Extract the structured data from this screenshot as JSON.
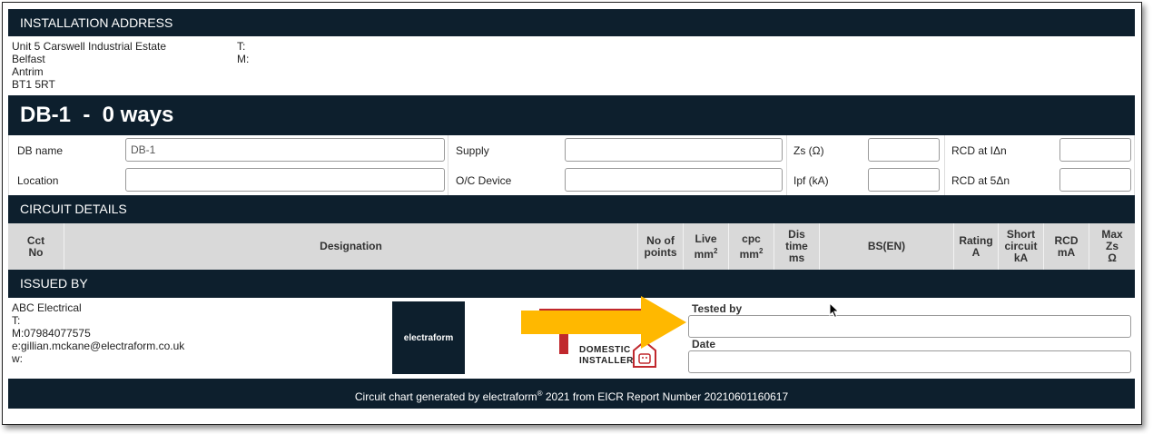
{
  "installation": {
    "title": "INSTALLATION ADDRESS",
    "address_lines": [
      "Unit 5 Carswell Industrial Estate",
      "Belfast",
      "Antrim",
      "BT1 5RT"
    ],
    "phone_label": "T:",
    "mobile_label": "M:"
  },
  "db": {
    "heading": "DB-1  -  0 ways",
    "fields": {
      "db_name_label": "DB name",
      "db_name_value": "DB-1",
      "location_label": "Location",
      "location_value": "",
      "supply_label": "Supply",
      "supply_value": "",
      "oc_device_label": "O/C Device",
      "oc_device_value": "",
      "zs_label": "Zs (Ω)",
      "zs_value": "",
      "ipf_label": "Ipf (kA)",
      "ipf_value": "",
      "rcd_idn_label": "RCD at IΔn",
      "rcd_idn_value": "",
      "rcd_5dn_label": "RCD at 5Δn",
      "rcd_5dn_value": ""
    }
  },
  "circuit": {
    "title": "CIRCUIT DETAILS",
    "columns": {
      "cct_no": [
        "Cct",
        "No"
      ],
      "designation": "Designation",
      "no_of_points": [
        "No of",
        "points"
      ],
      "live": [
        "Live",
        "mm",
        "2"
      ],
      "cpc": [
        "cpc",
        "mm",
        "2"
      ],
      "dis_time": [
        "Dis",
        "time",
        "ms"
      ],
      "bs_en": "BS(EN)",
      "rating": [
        "Rating",
        "A"
      ],
      "short_circuit": [
        "Short",
        "circuit",
        "kA"
      ],
      "rcd": [
        "RCD",
        "mA"
      ],
      "max_zs": [
        "Max",
        "Zs",
        "Ω"
      ]
    }
  },
  "issued_by": {
    "title": "ISSUED BY",
    "company": "ABC Electrical",
    "phone": "T:",
    "mobile": "M:07984077575",
    "email": "e:gillian.mckane@electraform.co.uk",
    "web": "w:",
    "logo_text": "electraform",
    "badge_line1": "DOMESTIC",
    "badge_line2": "INSTALLER",
    "tested_by_label": "Tested by",
    "date_label": "Date"
  },
  "footer": {
    "prefix": "Circuit chart generated by electraform",
    "reg_mark": "®",
    "suffix": " 2021 from EICR Report Number 20210601160617"
  },
  "colors": {
    "header_bar": "#0d1f2d",
    "table_header": "#d9d9d9",
    "arrow": "#ffb800",
    "badge_red": "#c0282d"
  }
}
